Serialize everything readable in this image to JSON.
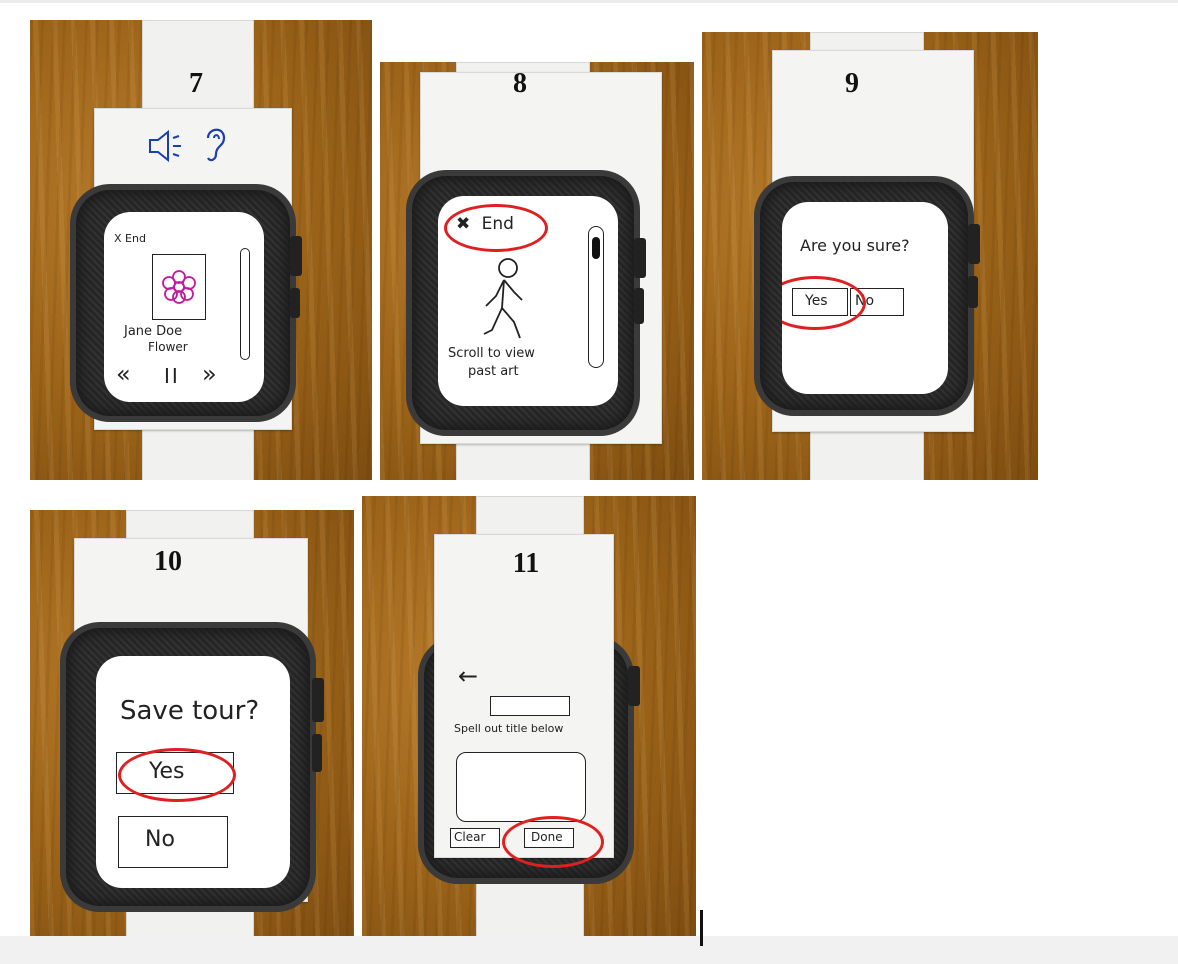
{
  "panels": [
    {
      "number": "7",
      "top_icons": [
        "speaker-icon",
        "ear-icon"
      ],
      "end_label": "X End",
      "artist": "Jane Doe",
      "artwork_title": "Flower",
      "controls": [
        "«",
        "II",
        "»"
      ]
    },
    {
      "number": "8",
      "end_label": "End",
      "caption_line1": "Scroll to view",
      "caption_line2": "past art"
    },
    {
      "number": "9",
      "question": "Are you sure?",
      "yes_label": "Yes",
      "no_label": "No"
    },
    {
      "number": "10",
      "question": "Save tour?",
      "yes_label": "Yes",
      "no_label": "No"
    },
    {
      "number": "11",
      "back_label": "←",
      "instruction": "Spell out title below",
      "clear_label": "Clear",
      "done_label": "Done"
    }
  ],
  "colors": {
    "highlight": "#e02020",
    "wood": "#9a6218",
    "sketch_ink": "#222222",
    "flower": "#c21a9a",
    "blue_ink": "#1a3fb0"
  }
}
